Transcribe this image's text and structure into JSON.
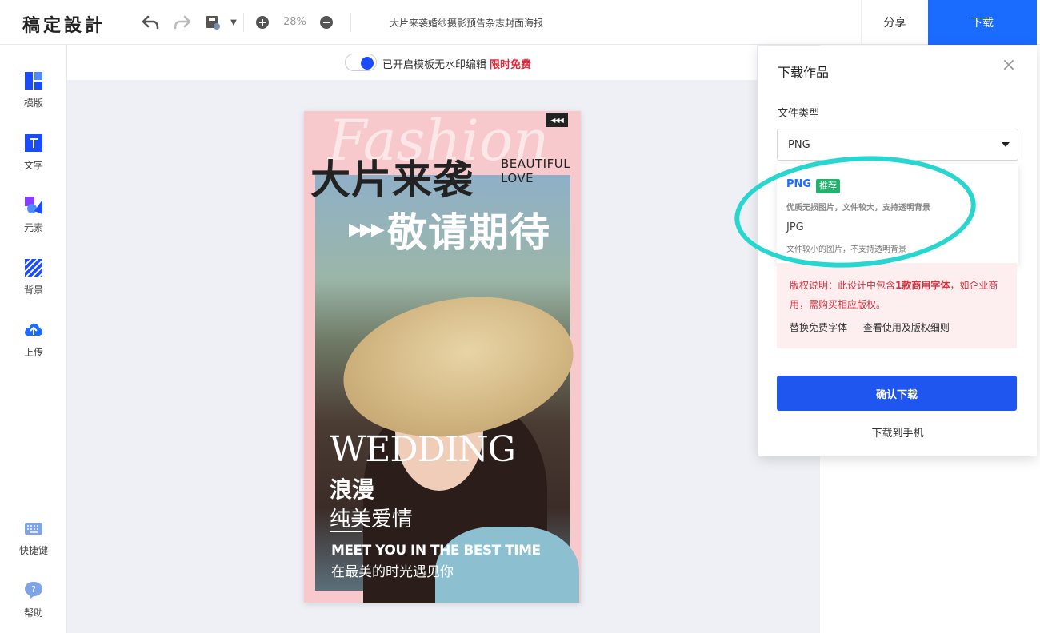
{
  "app": {
    "logo": "稿定設計"
  },
  "toolbar": {
    "zoom": "28%",
    "doc_title": "大片来袭婚纱摄影预告杂志封面海报",
    "share_label": "分享",
    "download_label": "下载"
  },
  "sidebar": {
    "items": [
      {
        "label": "模版",
        "icon": "template-icon"
      },
      {
        "label": "文字",
        "icon": "text-icon"
      },
      {
        "label": "元素",
        "icon": "elements-icon"
      },
      {
        "label": "背景",
        "icon": "background-icon"
      },
      {
        "label": "上传",
        "icon": "upload-icon"
      }
    ],
    "bottom": [
      {
        "label": "快捷键",
        "icon": "keyboard-icon"
      },
      {
        "label": "帮助",
        "icon": "help-icon"
      }
    ]
  },
  "watermark": {
    "text": "已开启模板无水印编辑",
    "free": "限时免费"
  },
  "poster": {
    "bg_text": "Fashion",
    "title": "大片来袭",
    "beautiful_line1": "BEAUTIFUL",
    "beautiful_line2": "LOVE",
    "arrows": "▶▶▶",
    "expect": "敬请期待",
    "wedding": "WEDDING",
    "romantic": "浪漫",
    "pure_love": "纯美爱情",
    "meet": "MEET YOU IN THE BEST TIME",
    "zai": "在最美的时光遇见你",
    "collapse": "◀◀◀"
  },
  "download_panel": {
    "title": "下载作品",
    "close": "×",
    "file_type_label": "文件类型",
    "selected": "PNG",
    "options": [
      {
        "name": "PNG",
        "badge": "推荐",
        "desc": "优质无损图片，文件较大，支持透明背景"
      },
      {
        "name": "JPG",
        "desc": "文件较小的图片，不支持透明背景"
      }
    ],
    "copyright": {
      "prefix": "版权说明：此设计中包含",
      "bold": "1款商用字体",
      "suffix": "，如企业商用，需购买相应版权。",
      "link1": "替换免费字体",
      "link2": "查看使用及版权细则"
    },
    "confirm": "确认下载",
    "to_phone": "下载到手机"
  },
  "colors": {
    "accent": "#1a6bff",
    "confirm": "#1f56f0",
    "highlight": "#28d6d0",
    "warn": "#d0323e"
  }
}
